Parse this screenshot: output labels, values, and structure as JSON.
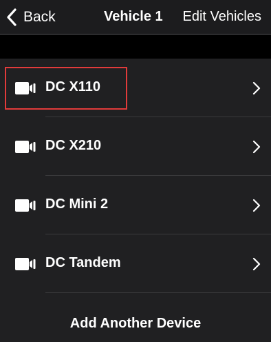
{
  "navbar": {
    "back_label": "Back",
    "title": "Vehicle 1",
    "edit_label": "Edit Vehicles"
  },
  "devices": [
    {
      "label": "DC X110",
      "icon": "video-camera-icon",
      "highlighted": true
    },
    {
      "label": "DC X210",
      "icon": "video-camera-icon",
      "highlighted": false
    },
    {
      "label": "DC Mini 2",
      "icon": "video-camera-icon",
      "highlighted": false
    },
    {
      "label": "DC Tandem",
      "icon": "video-camera-icon",
      "highlighted": false
    }
  ],
  "footer": {
    "add_device_label": "Add Another Device"
  },
  "colors": {
    "background": "#202022",
    "navbar": "#1c1c1e",
    "band": "#000000",
    "text": "#ffffff",
    "highlight": "#e23b3b"
  }
}
